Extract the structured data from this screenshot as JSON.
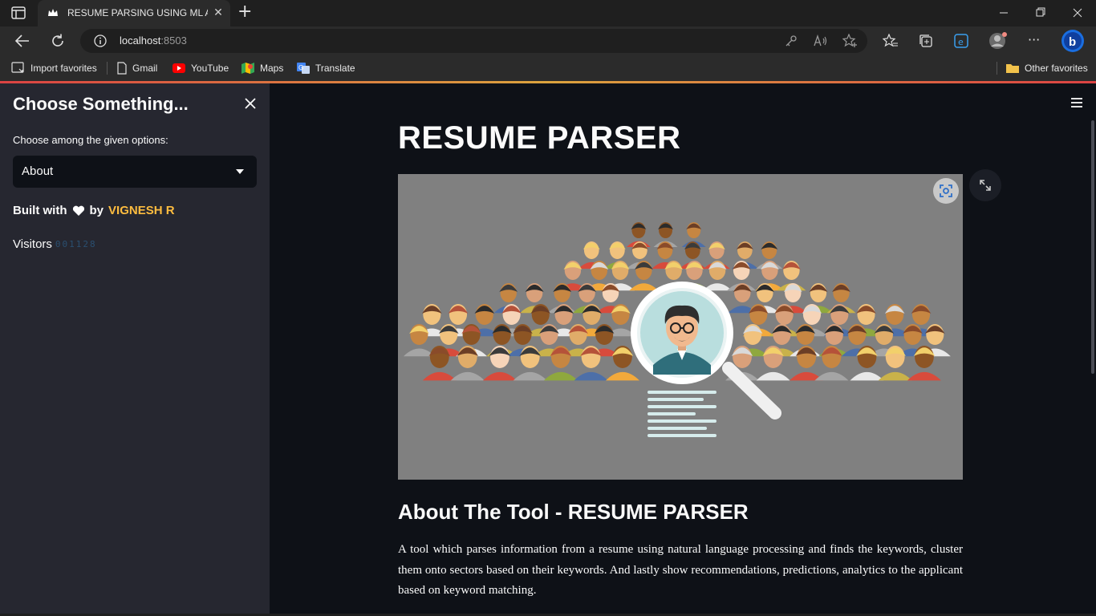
{
  "browser": {
    "tab_title": "RESUME PARSING USING ML AN",
    "url_host": "localhost",
    "url_port": ":8503",
    "bookmarks": [
      {
        "label": "Import favorites",
        "icon": "import-icon"
      },
      {
        "label": "Gmail",
        "icon": "page-icon"
      },
      {
        "label": "YouTube",
        "icon": "youtube-icon"
      },
      {
        "label": "Maps",
        "icon": "maps-icon"
      },
      {
        "label": "Translate",
        "icon": "translate-icon"
      }
    ],
    "other_favorites": "Other favorites"
  },
  "sidebar": {
    "title": "Choose Something...",
    "select_label": "Choose among the given options:",
    "select_value": "About",
    "built_prefix": "Built with",
    "built_by": "by",
    "author": "VIGNESH R",
    "visitors_label": "Visitors",
    "visitors_count": "001128"
  },
  "main": {
    "title": "RESUME PARSER",
    "section_title": "About The Tool - RESUME PARSER",
    "description": "A tool which parses information from a resume using natural language processing and finds the keywords, cluster them onto sectors based on their keywords. And lastly show recommendations, predictions, analytics to the applicant based on keyword matching."
  },
  "colors": {
    "accent": "#fdbc3f",
    "background": "#0e1117",
    "sidebar": "#262730",
    "hero_background": "#808080"
  }
}
